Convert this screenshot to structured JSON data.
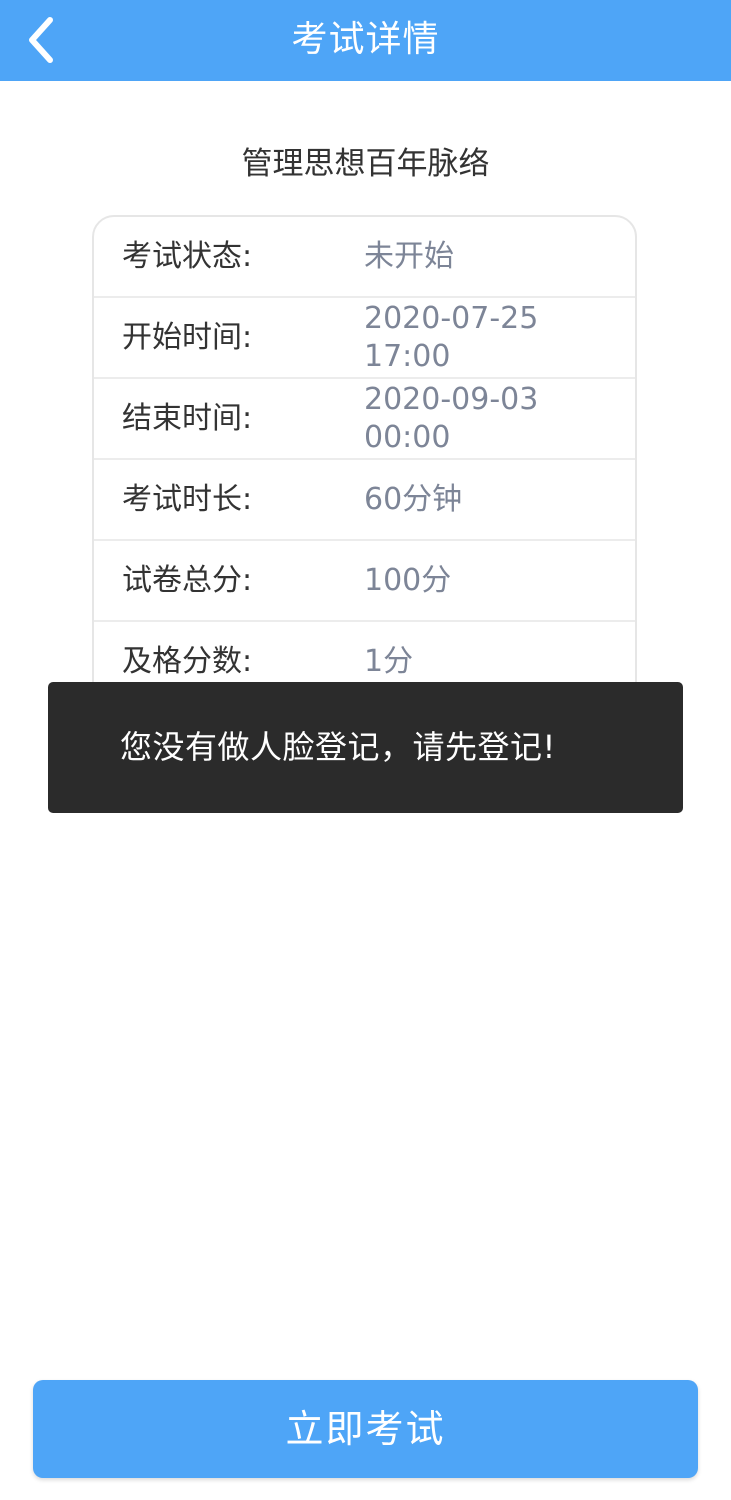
{
  "header": {
    "title": "考试详情",
    "back_icon": "chevron-left-icon"
  },
  "exam": {
    "name": "管理思想百年脉络",
    "rows": [
      {
        "label": "考试状态:",
        "value_line1": "未开始",
        "value_line2": ""
      },
      {
        "label": "开始时间:",
        "value_line1": "2020-07-25",
        "value_line2": "17:00"
      },
      {
        "label": "结束时间:",
        "value_line1": "2020-09-03",
        "value_line2": "00:00"
      },
      {
        "label": "考试时长:",
        "value_line1": "60分钟",
        "value_line2": ""
      },
      {
        "label": "试卷总分:",
        "value_line1": "100分",
        "value_line2": ""
      },
      {
        "label": "及格分数:",
        "value_line1": "1分",
        "value_line2": ""
      }
    ]
  },
  "toast": {
    "message": "您没有做人脸登记，请先登记!"
  },
  "footer": {
    "start_label": "立即考试"
  },
  "colors": {
    "accent": "#4ea5f7",
    "toast_bg": "#2b2b2b",
    "value_text": "#7d8597"
  }
}
